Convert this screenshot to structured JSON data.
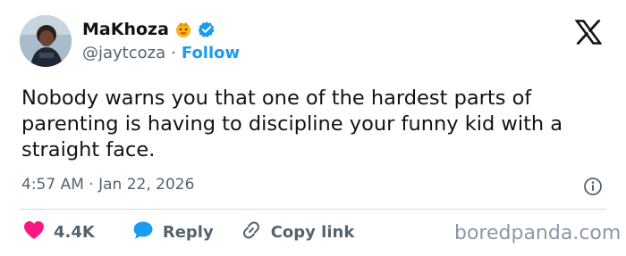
{
  "author": {
    "name": "MaKhoza",
    "handle": "@jaytcoza",
    "separator": "·",
    "follow_label": "Follow"
  },
  "tweet": {
    "text": "Nobody warns you that one of the hardest parts of parenting is having to discipline your funny kid with a straight face.",
    "time": "4:57 AM",
    "date": "Jan 22, 2026",
    "meta_separator": "·"
  },
  "actions": {
    "like_count": "4.4K",
    "reply_label": "Reply",
    "copy_link_label": "Copy link"
  },
  "watermark": "boredpanda.com",
  "colors": {
    "accent": "#1d9bf0",
    "like": "#f91880",
    "text": "#0f1419",
    "muted": "#536471",
    "divider": "#cfd9de"
  },
  "icons": [
    "avatar",
    "emoji-icon",
    "verified-badge-icon",
    "x-logo-icon",
    "info-icon",
    "heart-icon",
    "reply-bubble-icon",
    "link-icon"
  ]
}
